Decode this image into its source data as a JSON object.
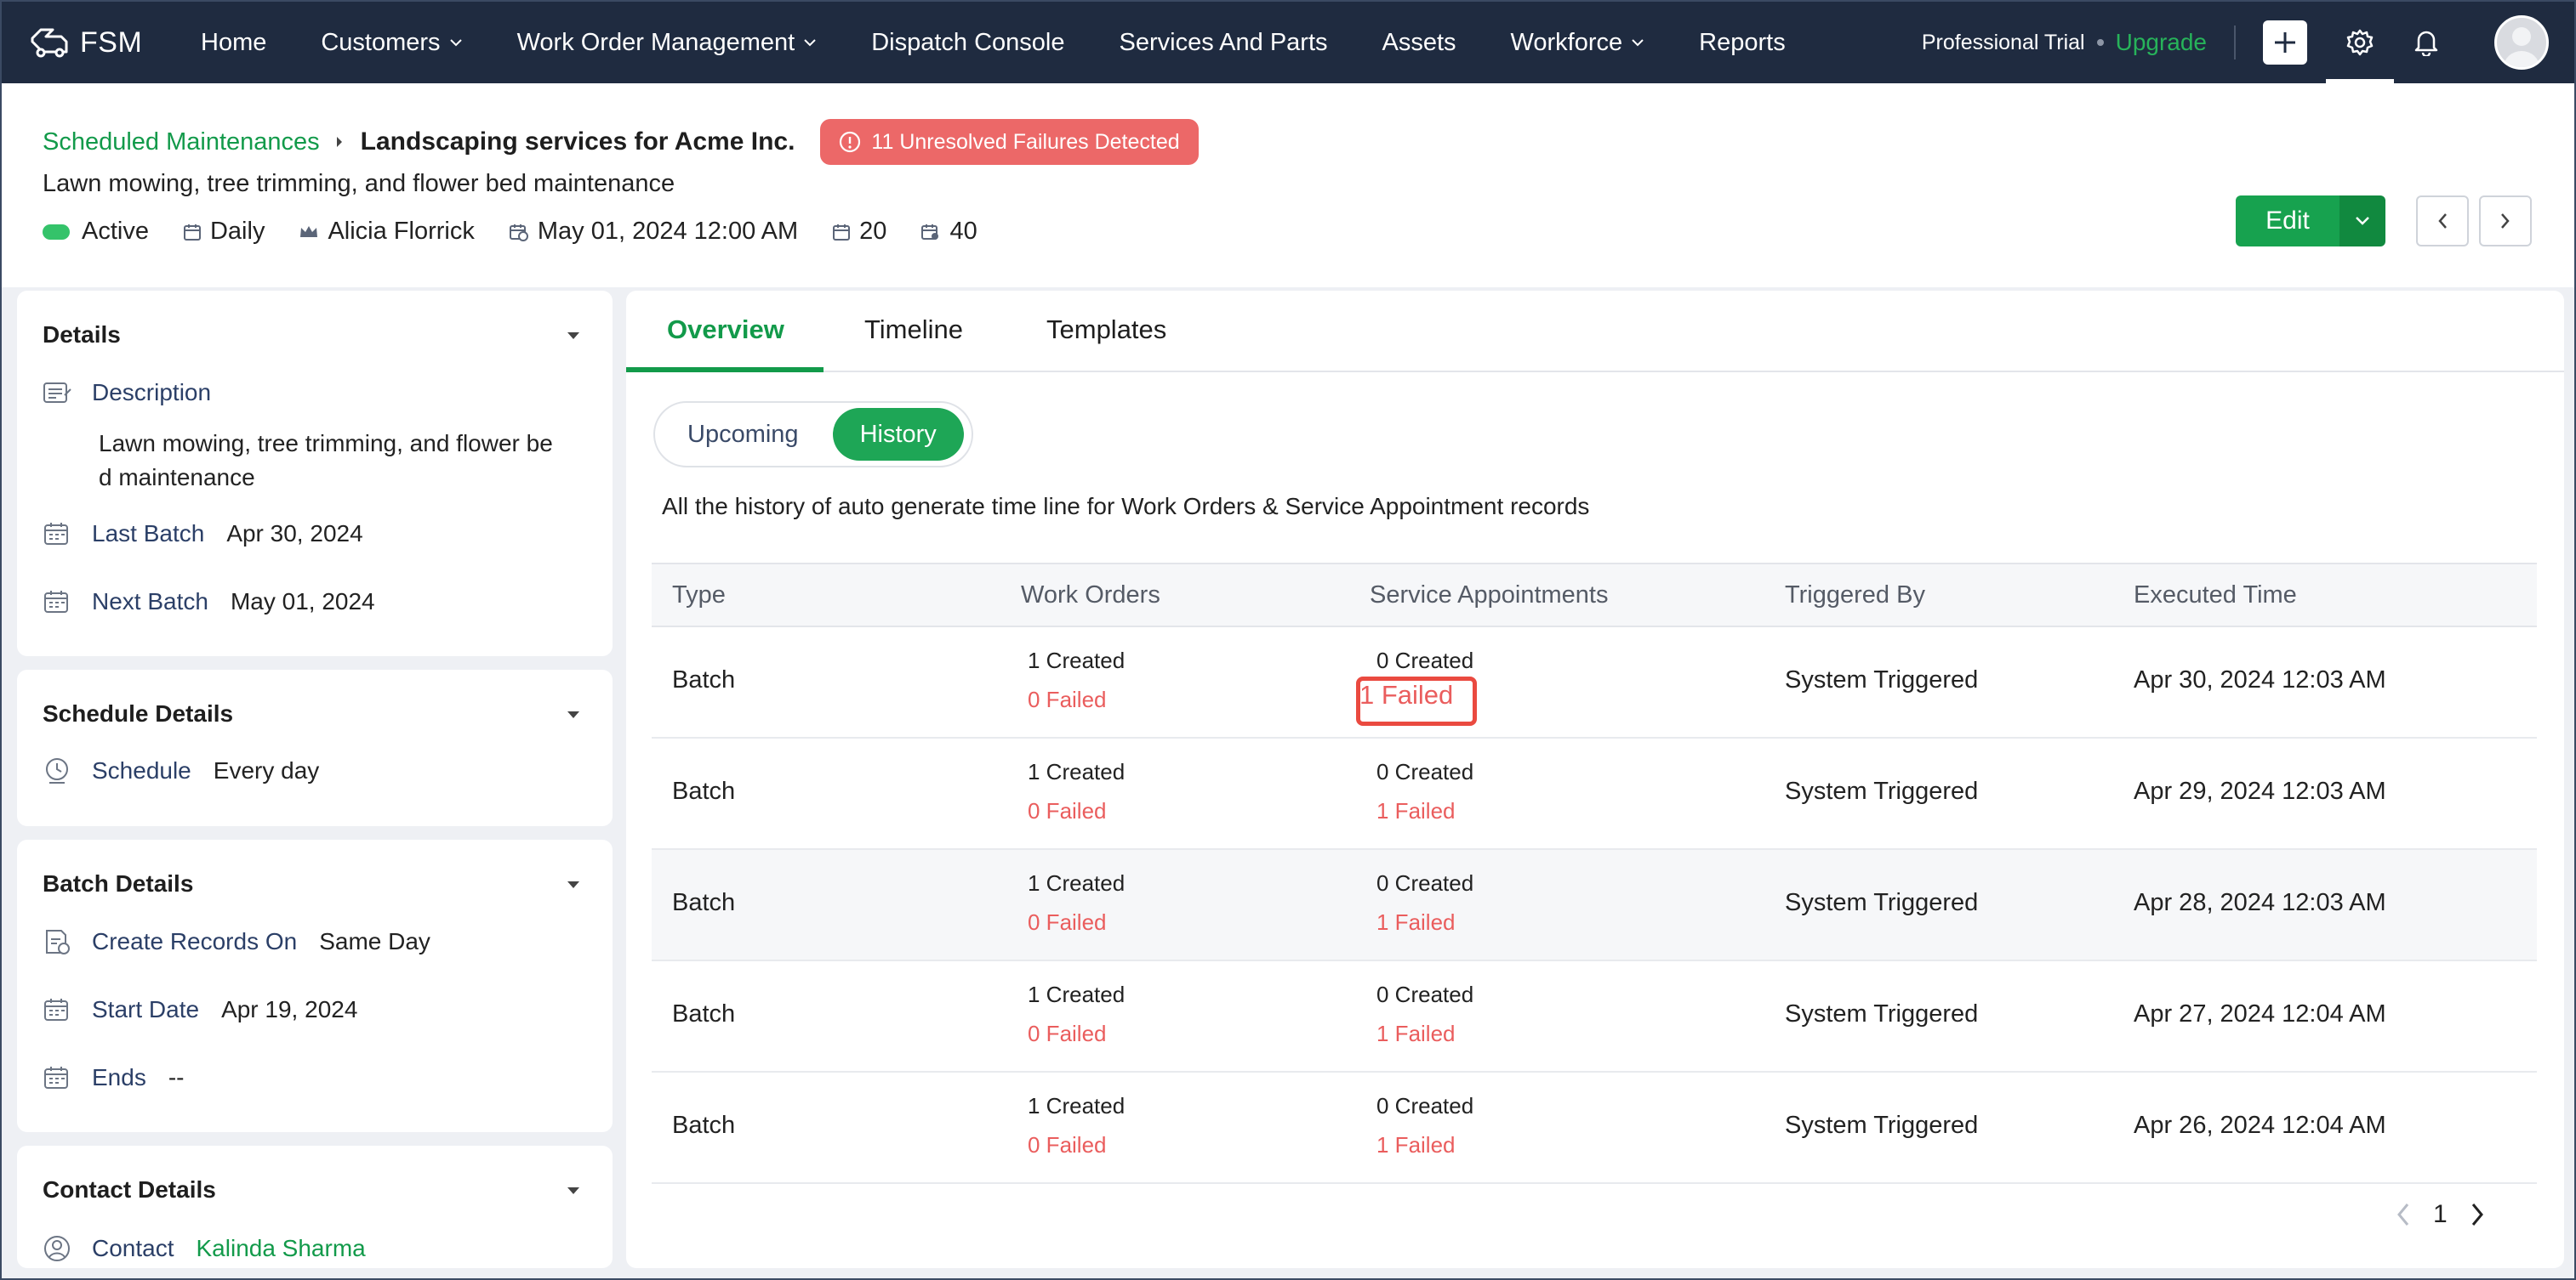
{
  "app": {
    "brand": "FSM",
    "nav": [
      {
        "label": "Home"
      },
      {
        "label": "Customers"
      },
      {
        "label": "Work Order Management"
      },
      {
        "label": "Dispatch Console"
      },
      {
        "label": "Services And Parts"
      },
      {
        "label": "Assets"
      },
      {
        "label": "Workforce"
      },
      {
        "label": "Reports"
      }
    ],
    "trial": "Professional Trial",
    "upgrade": "Upgrade"
  },
  "record": {
    "breadcrumb": "Scheduled Maintenances",
    "title": "Landscaping services for Acme Inc.",
    "failures_badge": "11 Unresolved Failures Detected",
    "description": "Lawn mowing, tree trimming, and flower bed maintenance",
    "status": "Active",
    "frequency": "Daily",
    "owner": "Alicia Florrick",
    "start": "May 01, 2024 12:00 AM",
    "count_a": "20",
    "count_b": "40",
    "edit_label": "Edit"
  },
  "details": {
    "title": "Details",
    "description_label": "Description",
    "description_value": "Lawn mowing, tree trimming, and flower bed maintenance",
    "last_batch_label": "Last Batch",
    "last_batch_value": "Apr 30, 2024",
    "next_batch_label": "Next Batch",
    "next_batch_value": "May 01, 2024"
  },
  "schedule": {
    "title": "Schedule Details",
    "label": "Schedule",
    "value": "Every day"
  },
  "batch": {
    "title": "Batch Details",
    "create_label": "Create Records On",
    "create_value": "Same Day",
    "start_label": "Start Date",
    "start_value": "Apr 19, 2024",
    "ends_label": "Ends",
    "ends_value": "--"
  },
  "contact": {
    "title": "Contact Details",
    "label": "Contact",
    "value": "Kalinda Sharma"
  },
  "main": {
    "tabs": [
      {
        "label": "Overview"
      },
      {
        "label": "Timeline"
      },
      {
        "label": "Templates"
      }
    ],
    "segments": [
      {
        "label": "Upcoming"
      },
      {
        "label": "History"
      }
    ],
    "note": "All the history of auto generate time line for Work Orders & Service Appointment records",
    "columns": [
      "Type",
      "Work Orders",
      "Service Appointments",
      "Triggered By",
      "Executed Time"
    ],
    "rows": [
      {
        "type": "Batch",
        "wo_created": "1 Created",
        "wo_failed": "0 Failed",
        "sa_created": "0 Created",
        "sa_failed": "1 Failed",
        "triggered": "System Triggered",
        "time": "Apr 30, 2024 12:03 AM"
      },
      {
        "type": "Batch",
        "wo_created": "1 Created",
        "wo_failed": "0 Failed",
        "sa_created": "0 Created",
        "sa_failed": "1 Failed",
        "triggered": "System Triggered",
        "time": "Apr 29, 2024 12:03 AM"
      },
      {
        "type": "Batch",
        "wo_created": "1 Created",
        "wo_failed": "0 Failed",
        "sa_created": "0 Created",
        "sa_failed": "1 Failed",
        "triggered": "System Triggered",
        "time": "Apr 28, 2024 12:03 AM"
      },
      {
        "type": "Batch",
        "wo_created": "1 Created",
        "wo_failed": "0 Failed",
        "sa_created": "0 Created",
        "sa_failed": "1 Failed",
        "triggered": "System Triggered",
        "time": "Apr 27, 2024 12:04 AM"
      },
      {
        "type": "Batch",
        "wo_created": "1 Created",
        "wo_failed": "0 Failed",
        "sa_created": "0 Created",
        "sa_failed": "1 Failed",
        "triggered": "System Triggered",
        "time": "Apr 26, 2024 12:04 AM"
      }
    ],
    "page": "1"
  },
  "colors": {
    "nav_bg": "#1f2b40",
    "accent": "#129a4a",
    "danger": "#ec6868"
  }
}
